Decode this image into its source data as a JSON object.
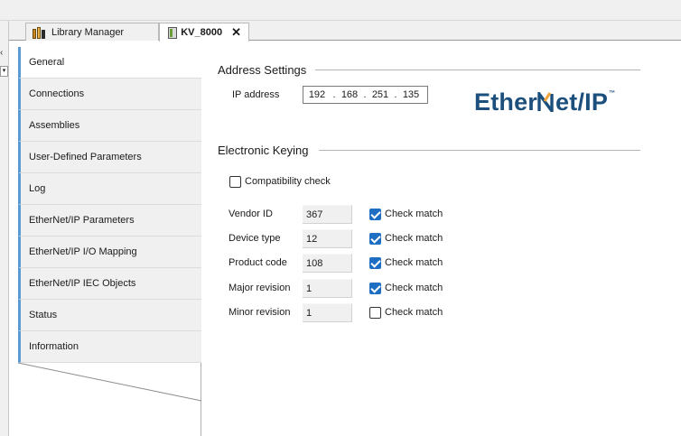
{
  "tabs": [
    {
      "label": "Library Manager",
      "icon": "library-icon",
      "active": false
    },
    {
      "label": "KV_8000",
      "icon": "device-icon",
      "active": true,
      "close": "✕"
    }
  ],
  "nav": {
    "items": [
      {
        "label": "General",
        "active": true
      },
      {
        "label": "Connections"
      },
      {
        "label": "Assemblies"
      },
      {
        "label": "User-Defined Parameters"
      },
      {
        "label": "Log"
      },
      {
        "label": "EtherNet/IP Parameters"
      },
      {
        "label": "EtherNet/IP I/O Mapping"
      },
      {
        "label": "EtherNet/IP IEC Objects"
      },
      {
        "label": "Status"
      },
      {
        "label": "Information"
      }
    ]
  },
  "address": {
    "title": "Address Settings",
    "ip_label": "IP address",
    "ip": [
      "192",
      "168",
      "251",
      "135"
    ],
    "separator": "."
  },
  "logo": {
    "text_left": "Ether",
    "text_right": "et/IP",
    "tm": "™",
    "color": "#1d4f7c"
  },
  "keying": {
    "title": "Electronic Keying",
    "compat_label": "Compatibility check",
    "compat_checked": false,
    "check_match_label": "Check match",
    "rows": [
      {
        "label": "Vendor ID",
        "value": "367",
        "checked": true
      },
      {
        "label": "Device type",
        "value": "12",
        "checked": true
      },
      {
        "label": "Product code",
        "value": "108",
        "checked": true
      },
      {
        "label": "Major revision",
        "value": "1",
        "checked": true
      },
      {
        "label": "Minor revision",
        "value": "1",
        "checked": false
      }
    ]
  },
  "colors": {
    "accent": "#1e6fc4",
    "nav_marker": "#5b9bd5"
  }
}
